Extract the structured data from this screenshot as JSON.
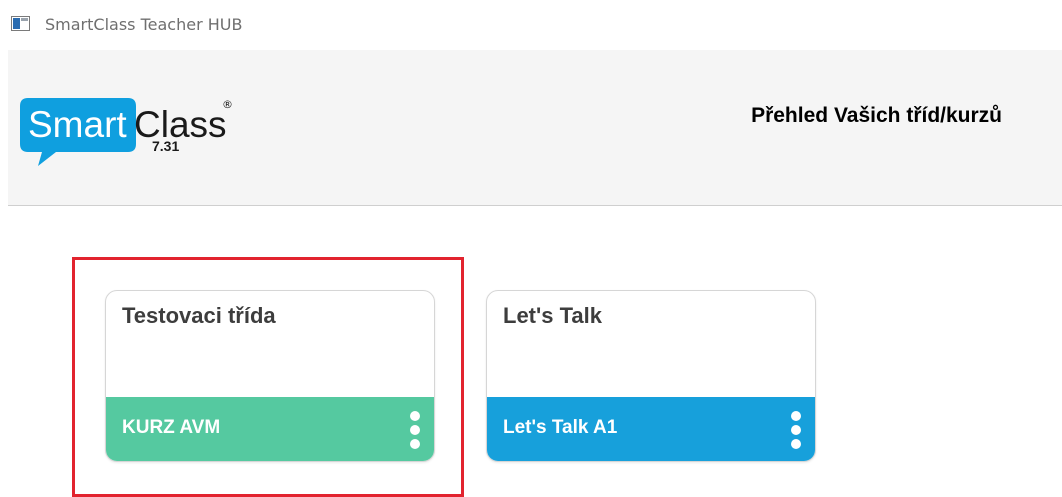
{
  "window": {
    "title": "SmartClass Teacher HUB"
  },
  "header": {
    "logo_word_smart": "Smart",
    "logo_word_class": "Class",
    "logo_registered": "®",
    "version": "7.31",
    "page_title": "Přehled Vašich tříd/kurzů"
  },
  "cards": [
    {
      "title": "Testovaci třída",
      "footer_label": "KURZ AVM",
      "footer_color": "#55c9a0",
      "selected": true
    },
    {
      "title": "Let's Talk",
      "footer_label": "Let's Talk A1",
      "footer_color": "#17a0db",
      "selected": false
    }
  ],
  "colors": {
    "logo_bubble": "#0f9fdf",
    "logo_text_dark": "#1a1a1a",
    "highlight": "#e2232e"
  }
}
